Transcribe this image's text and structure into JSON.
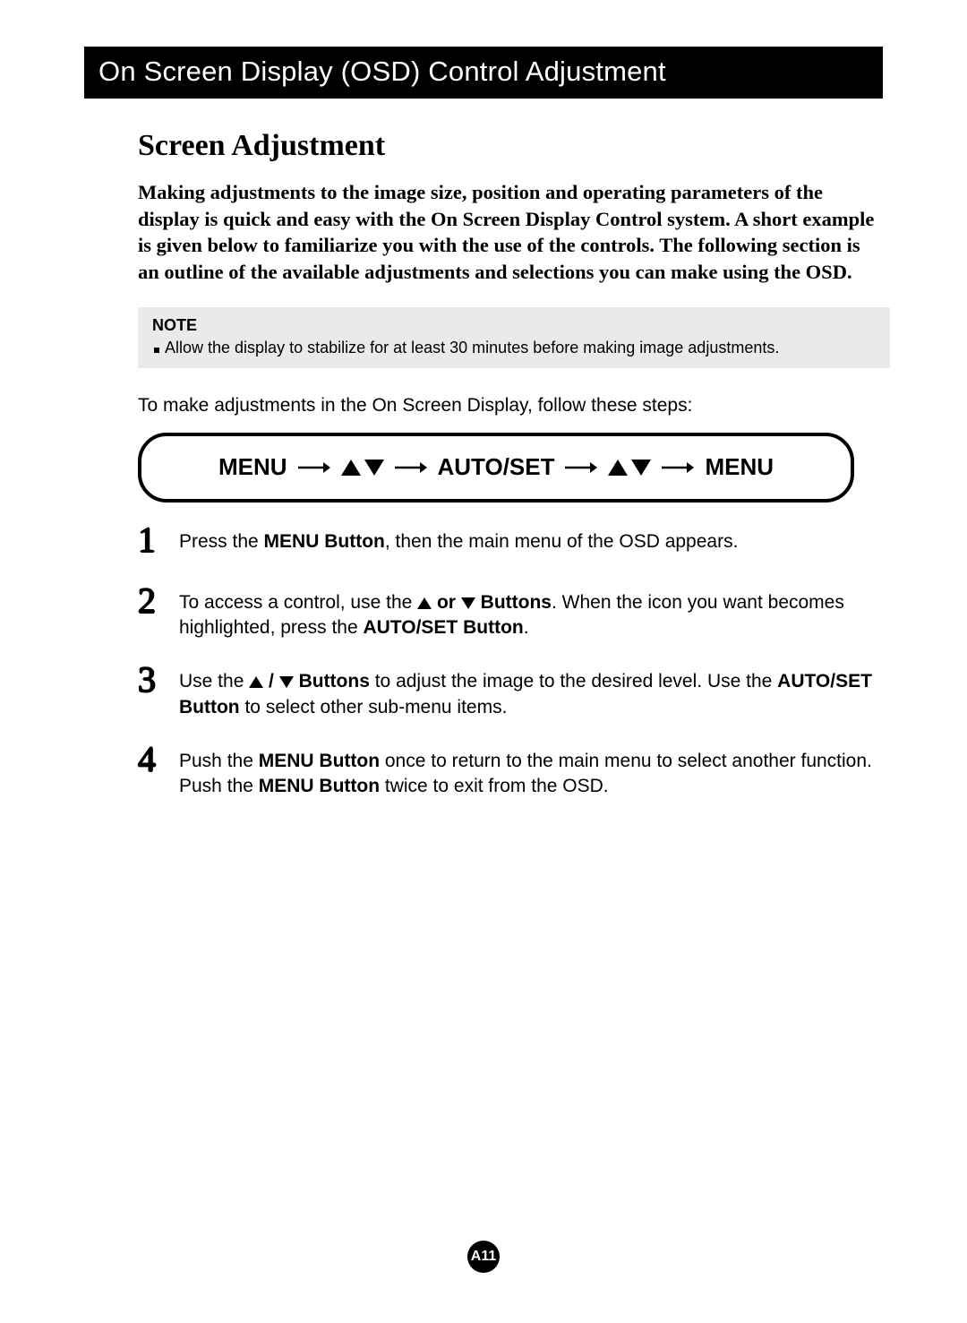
{
  "header": {
    "title": "On Screen Display (OSD) Control Adjustment"
  },
  "section": {
    "title": "Screen Adjustment"
  },
  "intro": {
    "text": "Making adjustments to the image size, position and operating parameters of the display is quick and easy with the On Screen Display Control system. A short example is given below to familiarize you with the use of the controls. The following section is an outline of the available adjustments and selections you can make using the OSD."
  },
  "note": {
    "label": "NOTE",
    "item": "Allow the display to stabilize for at least 30 minutes before making image adjustments."
  },
  "lead": "To make adjustments in the On Screen Display, follow these steps:",
  "flow": {
    "menu": "MENU",
    "autoset": "AUTO/SET"
  },
  "steps": {
    "s1": {
      "pre": "Press the ",
      "bold": "MENU Button",
      "post": ", then the main menu of the OSD appears."
    },
    "s2": {
      "pre": "To access a control, use the ",
      "boldmid": "or",
      "boldend": "Buttons",
      "post1": ". When the icon you want becomes highlighted, press the ",
      "bold2": "AUTO/SET Button",
      "post2": "."
    },
    "s3": {
      "pre": "Use the  ",
      "slash": " / ",
      "boldend": " Buttons",
      "post1": " to adjust the image to the desired level. Use the ",
      "bold2": "AUTO/SET Button",
      "post2": " to select other sub-menu items."
    },
    "s4": {
      "pre": "Push the ",
      "bold1": "MENU Button",
      "mid": " once to return to the main menu to select another function. Push the ",
      "bold2": "MENU Button",
      "post": " twice to exit from the OSD."
    }
  },
  "page_number": "A11"
}
